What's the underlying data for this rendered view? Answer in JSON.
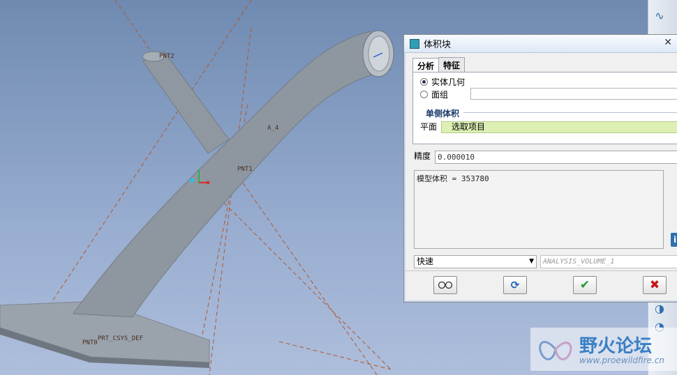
{
  "viewport": {
    "labels": {
      "pnt2": "PNT2",
      "pnt1": "PNT1",
      "a4": "A_4",
      "csys": "PRT_CSYS_DEF",
      "pnt0": "PNT0"
    },
    "colors": {
      "background": "#8aa1c6",
      "part": "#8e97a0",
      "datum": "#b2572a"
    }
  },
  "dialog": {
    "title": "体积块",
    "close_glyph": "✕",
    "tabs": [
      "分析",
      "特征"
    ],
    "radios": [
      {
        "label": "实体几何",
        "selected": true
      },
      {
        "label": "面组",
        "selected": false
      }
    ],
    "group_label": "单侧体积",
    "plane_label": "平面",
    "plane_value": "选取项目",
    "precision_label": "精度",
    "precision_value": "0.000010",
    "result_text": "模型体积 = 353780",
    "mode_value": "快速",
    "analysis_name": "ANALYSIS_VOLUME_1",
    "buttons": {
      "preview_icon": "glasses-icon",
      "repeat_icon": "refresh-icon",
      "ok_icon": "check-icon",
      "cancel_icon": "x-icon"
    }
  },
  "watermark": {
    "title": "野火论坛",
    "url": "www.proewildfire.cn"
  }
}
